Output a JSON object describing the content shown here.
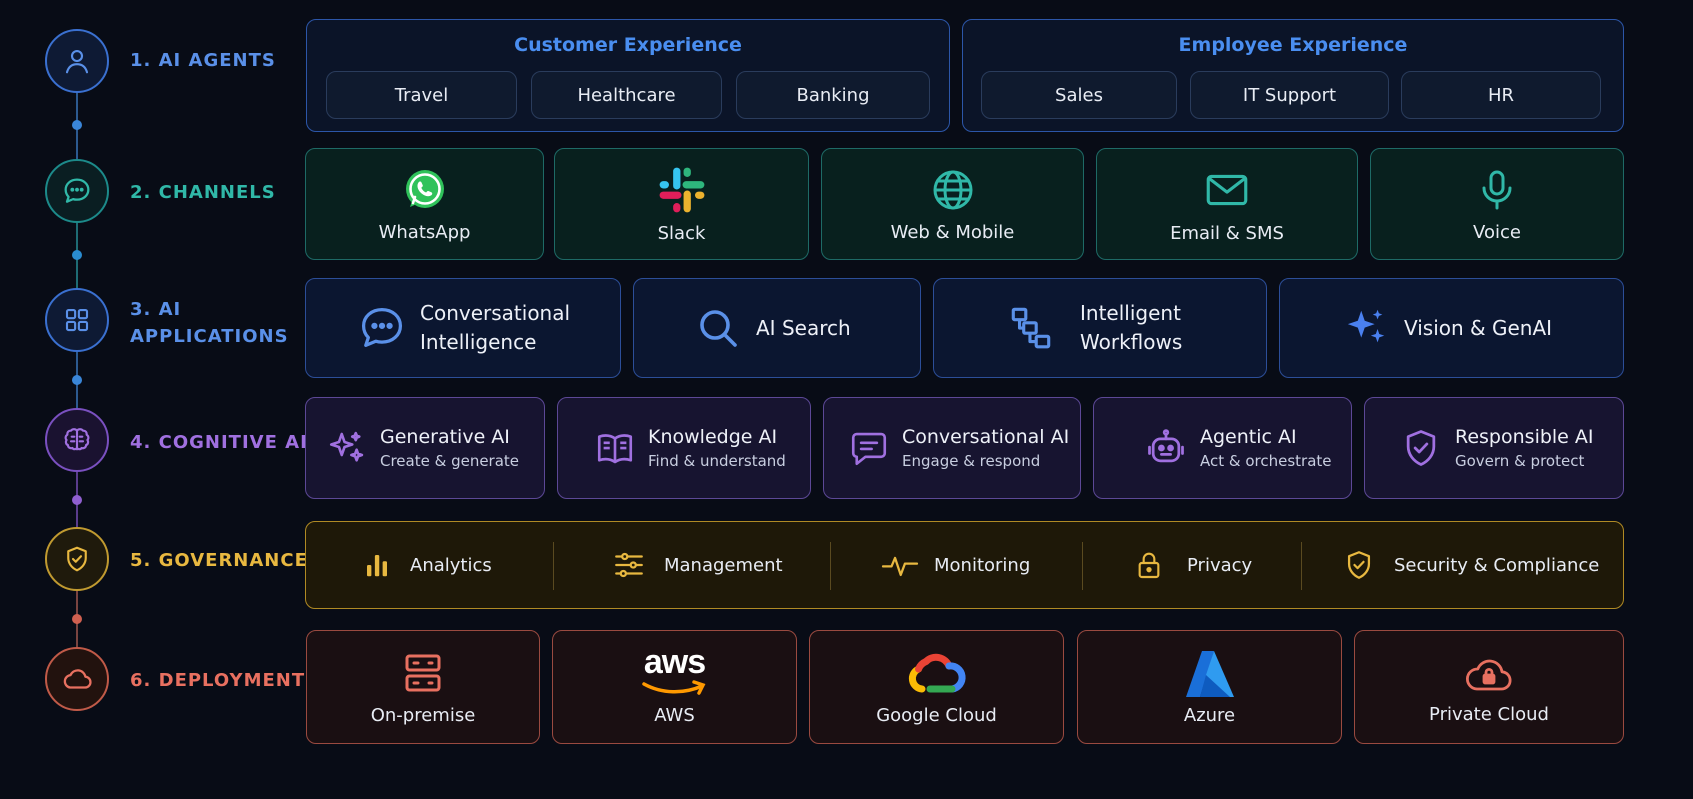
{
  "tiers": [
    {
      "label": "1. AI AGENTS",
      "color": "#5a90e8"
    },
    {
      "label": "2. CHANNELS",
      "color": "#30b8a8"
    },
    {
      "label": "3. AI APPLICATIONS",
      "label_l1": "3. AI",
      "label_l2": "APPLICATIONS",
      "color": "#5a90e8"
    },
    {
      "label": "4. COGNITIVE AI",
      "color": "#a070e0"
    },
    {
      "label": "5. GOVERNANCE",
      "color": "#e8b840"
    },
    {
      "label": "6. DEPLOYMENT",
      "color": "#e87060"
    }
  ],
  "agents": {
    "customer": {
      "title": "Customer Experience",
      "items": [
        "Travel",
        "Healthcare",
        "Banking"
      ]
    },
    "employee": {
      "title": "Employee Experience",
      "items": [
        "Sales",
        "IT Support",
        "HR"
      ]
    }
  },
  "channels": [
    {
      "label": "WhatsApp",
      "icon": "whatsapp-icon"
    },
    {
      "label": "Slack",
      "icon": "slack-icon"
    },
    {
      "label": "Web & Mobile",
      "icon": "globe-icon"
    },
    {
      "label": "Email & SMS",
      "icon": "mail-icon"
    },
    {
      "label": "Voice",
      "icon": "microphone-icon"
    }
  ],
  "applications": [
    {
      "l1": "Conversational",
      "l2": "Intelligence",
      "icon": "chat-bubble-icon"
    },
    {
      "label": "AI Search",
      "icon": "search-icon"
    },
    {
      "l1": "Intelligent",
      "l2": "Workflows",
      "icon": "workflow-icon"
    },
    {
      "label": "Vision & GenAI",
      "icon": "sparkles-icon"
    }
  ],
  "cognitive": [
    {
      "title": "Generative AI",
      "sub": "Create & generate",
      "icon": "sparkles-icon"
    },
    {
      "title": "Knowledge AI",
      "sub": "Find & understand",
      "icon": "book-icon"
    },
    {
      "title": "Conversational AI",
      "sub": "Engage & respond",
      "icon": "message-icon"
    },
    {
      "title": "Agentic AI",
      "sub": "Act & orchestrate",
      "icon": "robot-icon"
    },
    {
      "title": "Responsible AI",
      "sub": "Govern & protect",
      "icon": "shield-check-icon"
    }
  ],
  "governance": [
    {
      "label": "Analytics",
      "icon": "bar-chart-icon"
    },
    {
      "label": "Management",
      "icon": "sliders-icon"
    },
    {
      "label": "Monitoring",
      "icon": "pulse-icon"
    },
    {
      "label": "Privacy",
      "icon": "lock-icon"
    },
    {
      "label": "Security & Compliance",
      "icon": "shield-check-icon"
    }
  ],
  "deployment": [
    {
      "label": "On-premise",
      "icon": "server-icon"
    },
    {
      "label": "AWS",
      "logo": "aws",
      "icon": "aws-logo"
    },
    {
      "label": "Google Cloud",
      "icon": "google-cloud-logo"
    },
    {
      "label": "Azure",
      "icon": "azure-logo"
    },
    {
      "label": "Private Cloud",
      "icon": "cloud-lock-icon"
    }
  ]
}
